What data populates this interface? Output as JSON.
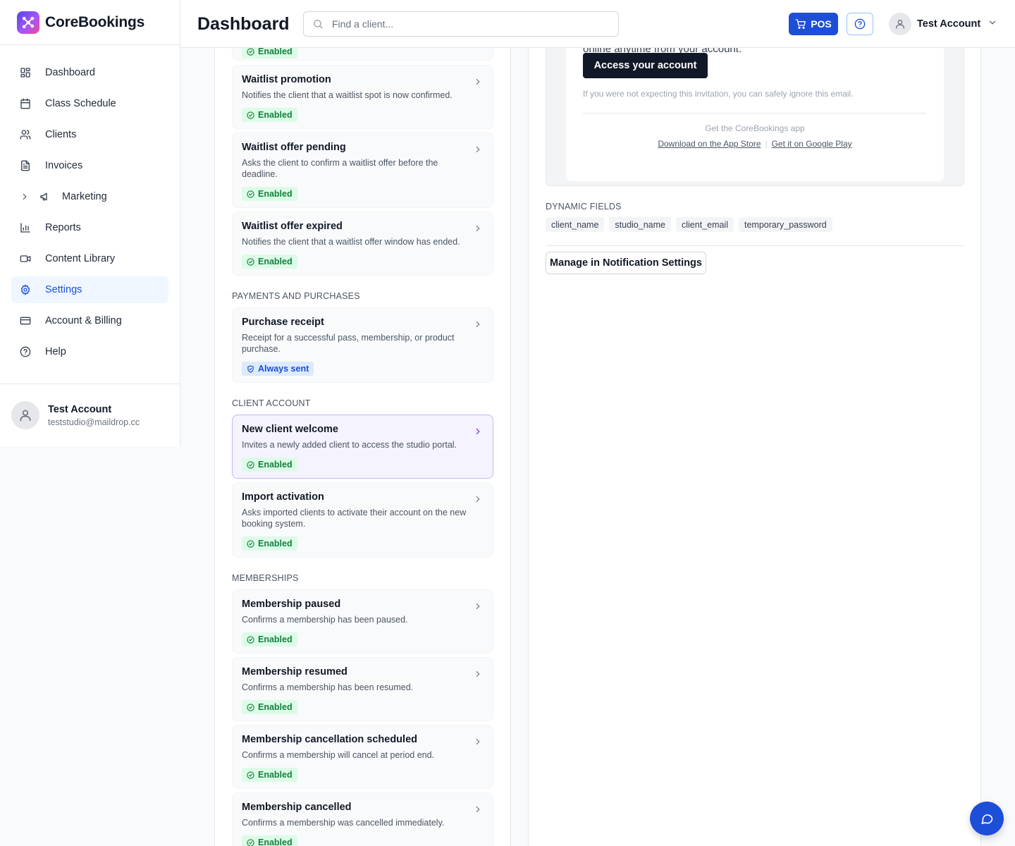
{
  "app": {
    "name": "CoreBookings"
  },
  "sidebar": {
    "items": [
      {
        "label": "Dashboard",
        "icon": "dashboard-icon"
      },
      {
        "label": "Class Schedule",
        "icon": "calendar-icon"
      },
      {
        "label": "Clients",
        "icon": "users-icon"
      },
      {
        "label": "Invoices",
        "icon": "document-icon"
      },
      {
        "label": "Marketing",
        "icon": "megaphone-icon"
      },
      {
        "label": "Reports",
        "icon": "bar-chart-icon"
      },
      {
        "label": "Content Library",
        "icon": "video-icon"
      },
      {
        "label": "Settings",
        "icon": "gear-icon",
        "active": true
      },
      {
        "label": "Account & Billing",
        "icon": "credit-card-icon"
      },
      {
        "label": "Help",
        "icon": "help-circle-icon"
      }
    ],
    "account": {
      "name": "Test Account",
      "email": "teststudio@maildrop.cc"
    }
  },
  "header": {
    "title": "Dashboard",
    "search_placeholder": "Find a client...",
    "pos_label": "POS",
    "user_name": "Test Account"
  },
  "notifications": {
    "cut_badge": "Enabled",
    "waitlist": [
      {
        "title": "Waitlist promotion",
        "desc": "Notifies the client that a waitlist spot is now confirmed.",
        "status": "Enabled"
      },
      {
        "title": "Waitlist offer pending",
        "desc": "Asks the client to confirm a waitlist offer before the deadline.",
        "status": "Enabled"
      },
      {
        "title": "Waitlist offer expired",
        "desc": "Notifies the client that a waitlist offer window has ended.",
        "status": "Enabled"
      }
    ],
    "payments_label": "PAYMENTS AND PURCHASES",
    "payments": [
      {
        "title": "Purchase receipt",
        "desc": "Receipt for a successful pass, membership, or product purchase.",
        "status": "Always sent"
      }
    ],
    "client_account_label": "CLIENT ACCOUNT",
    "client_account": [
      {
        "title": "New client welcome",
        "desc": "Invites a newly added client to access the studio portal.",
        "status": "Enabled",
        "selected": true
      },
      {
        "title": "Import activation",
        "desc": "Asks imported clients to activate their account on the new booking system.",
        "status": "Enabled"
      }
    ],
    "memberships_label": "MEMBERSHIPS",
    "memberships": [
      {
        "title": "Membership paused",
        "desc": "Confirms a membership has been paused.",
        "status": "Enabled"
      },
      {
        "title": "Membership resumed",
        "desc": "Confirms a membership has been resumed.",
        "status": "Enabled"
      },
      {
        "title": "Membership cancellation scheduled",
        "desc": "Confirms a membership will cancel at period end.",
        "status": "Enabled"
      },
      {
        "title": "Membership cancelled",
        "desc": "Confirms a membership was cancelled immediately.",
        "status": "Enabled"
      }
    ]
  },
  "detail": {
    "email_cut_text": "online anytime from your account.",
    "access_button": "Access your account",
    "ignore_note": "If you were not expecting this invitation, you can safely ignore this email.",
    "app_line": "Get the CoreBookings app",
    "app_store_link": "Download on the App Store",
    "store_separator": "|",
    "google_play_link": "Get it on Google Play",
    "dynamic_fields_label": "DYNAMIC FIELDS",
    "dynamic_fields": [
      "client_name",
      "studio_name",
      "client_email",
      "temporary_password"
    ],
    "manage_button": "Manage in Notification Settings"
  },
  "colors": {
    "accent": "#1d4ed8",
    "selected_card_bg": "#f5f3ff",
    "selected_card_border": "#c4b5fd",
    "enabled_badge_bg": "#dcfce7",
    "enabled_badge_text": "#15803d"
  }
}
